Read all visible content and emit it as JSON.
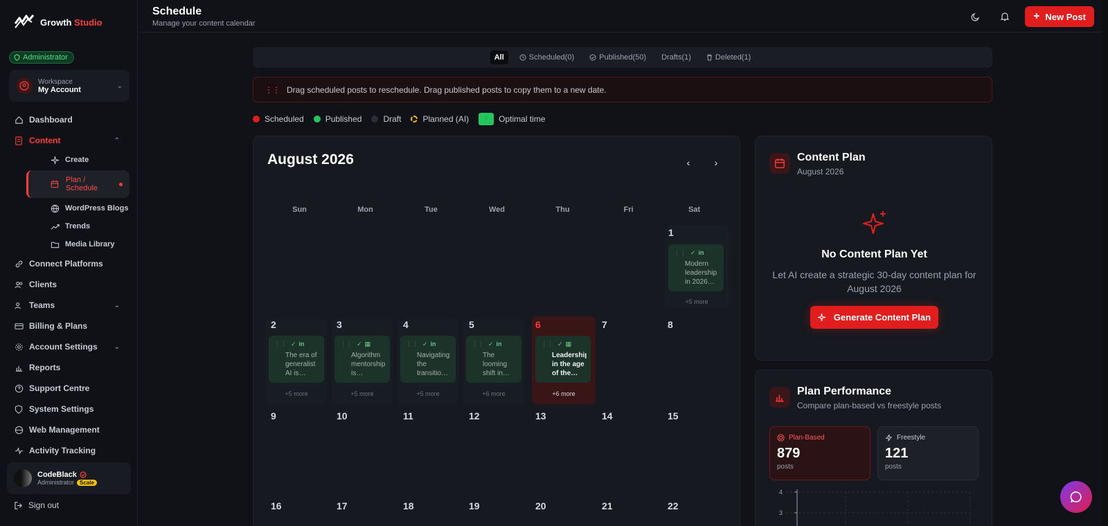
{
  "brand": {
    "name_prefix": "Growth",
    "name_suffix": "Studio",
    "logo_caption": "Growth Studio"
  },
  "role_badge": "Administrator",
  "workspace": {
    "label": "Workspace",
    "name": "My Account"
  },
  "nav": {
    "dashboard": "Dashboard",
    "content": "Content",
    "create": "Create",
    "plan_schedule_line1": "Plan /",
    "plan_schedule_line2": "Schedule",
    "wordpress": "WordPress Blogs",
    "trends": "Trends",
    "media": "Media Library",
    "connect": "Connect Platforms",
    "clients": "Clients",
    "teams": "Teams",
    "billing": "Billing & Plans",
    "account": "Account Settings",
    "reports": "Reports",
    "support": "Support Centre",
    "system": "System Settings",
    "web": "Web Management",
    "activity": "Activity Tracking"
  },
  "user": {
    "name": "CodeBlack",
    "role": "Administrator",
    "badge": "Scale"
  },
  "signout": "Sign out",
  "header": {
    "title": "Schedule",
    "subtitle": "Manage your content calendar",
    "new_post": "New Post"
  },
  "filters": {
    "all": "All",
    "scheduled": "Scheduled(0)",
    "published": "Published(50)",
    "drafts": "Drafts(1)",
    "deleted": "Deleted(1)"
  },
  "hint": "Drag scheduled posts to reschedule. Drag published posts to copy them to a new date.",
  "legend": {
    "scheduled": "Scheduled",
    "published": "Published",
    "draft": "Draft",
    "planned": "Planned (AI)",
    "optimal": "Optimal time"
  },
  "calendar": {
    "month": "August 2026",
    "weekdays": [
      "Sun",
      "Mon",
      "Tue",
      "Wed",
      "Thu",
      "Fri",
      "Sat"
    ],
    "days": {
      "d1": "1",
      "d2": "2",
      "d3": "3",
      "d4": "4",
      "d5": "5",
      "d6": "6",
      "d7": "7",
      "d8": "8",
      "d9": "9",
      "d10": "10",
      "d11": "11",
      "d12": "12",
      "d13": "13",
      "d14": "14",
      "d15": "15",
      "d16": "16",
      "d17": "17",
      "d18": "18",
      "d19": "19",
      "d20": "20",
      "d21": "21",
      "d22": "22"
    },
    "posts": {
      "p1": "Modern leadership in 2026…",
      "p2": "The era of generalist AI is…",
      "p3": "Algorithm mentorship is…",
      "p4": "Navigating the transitio…",
      "p5": "The looming shift in…",
      "p6": "Leadership in the age of the…"
    },
    "more": {
      "m1": "+5 more",
      "m2": "+5 more",
      "m3": "+5 more",
      "m4": "+5 more",
      "m5": "+6 more",
      "m6": "+6 more"
    }
  },
  "content_plan": {
    "title": "Content Plan",
    "subtitle": "August 2026",
    "empty_title": "No Content Plan Yet",
    "empty_desc": "Let AI create a strategic 30-day content plan for August 2026",
    "button": "Generate Content Plan"
  },
  "performance": {
    "title": "Plan Performance",
    "subtitle": "Compare plan-based vs freestyle posts",
    "plan_label": "Plan-Based",
    "plan_value": "879",
    "plan_unit": "posts",
    "free_label": "Freestyle",
    "free_value": "121",
    "free_unit": "posts",
    "axis_4": "4",
    "axis_3": "3"
  },
  "colors": {
    "accent": "#e11d1d",
    "published": "#22c55e",
    "planned": "#f5c400"
  }
}
